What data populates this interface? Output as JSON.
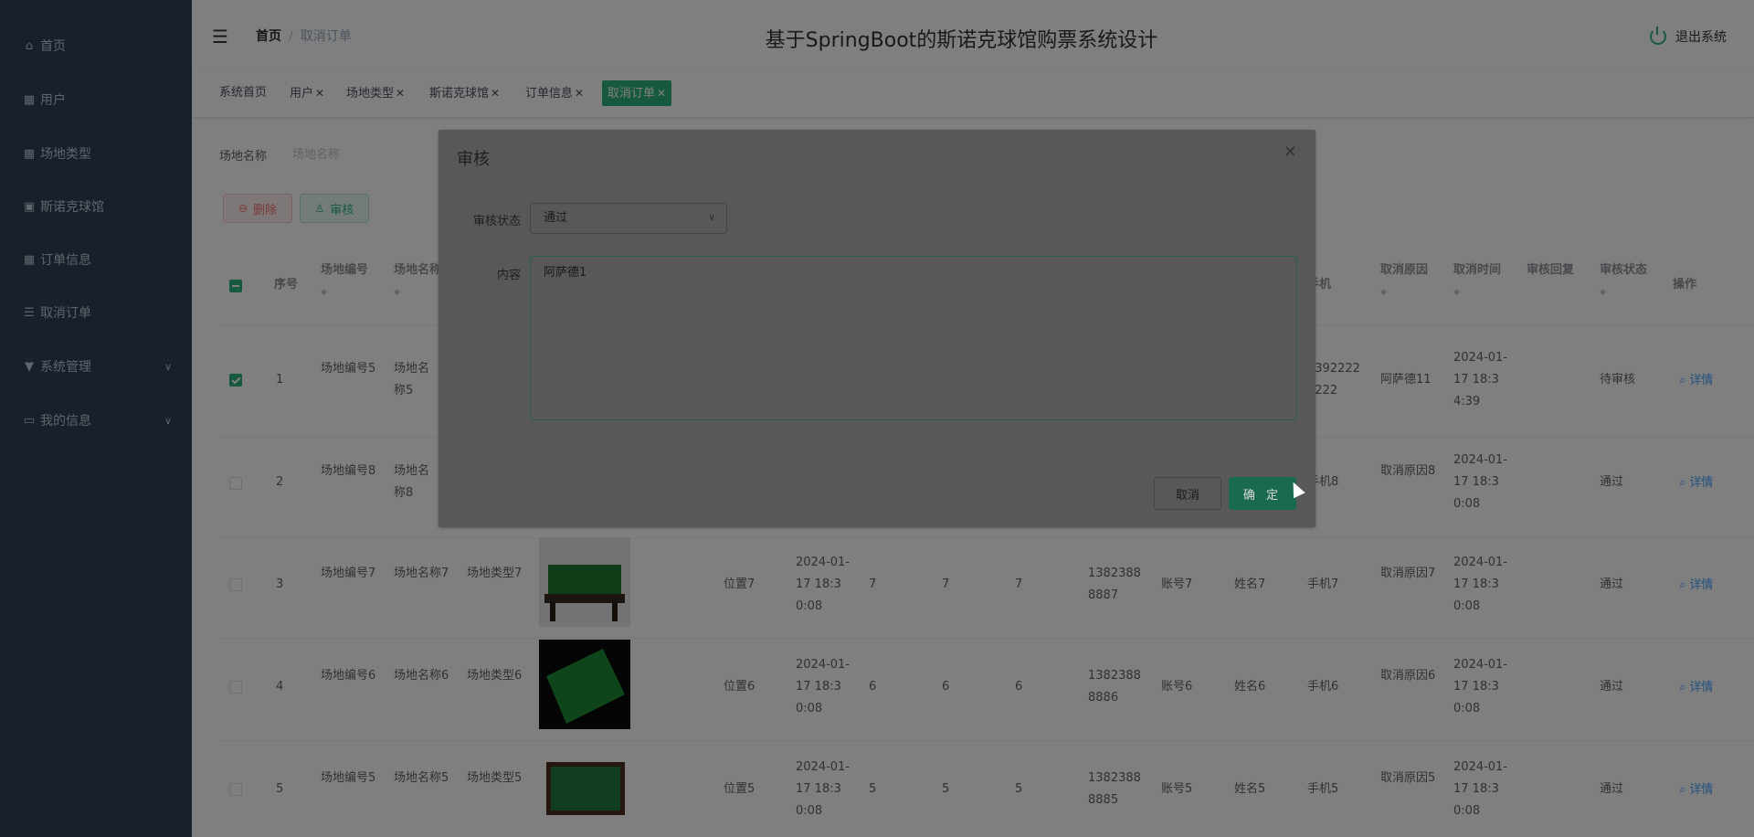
{
  "sidebar": {
    "items": [
      {
        "label": "首页",
        "icon": "home-icon"
      },
      {
        "label": "用户",
        "icon": "grid-icon"
      },
      {
        "label": "场地类型",
        "icon": "grid-icon"
      },
      {
        "label": "斯诺克球馆",
        "icon": "clipboard-icon"
      },
      {
        "label": "订单信息",
        "icon": "grid-icon"
      },
      {
        "label": "取消订单",
        "icon": "list-icon"
      },
      {
        "label": "系统管理",
        "icon": "settings-icon"
      },
      {
        "label": "我的信息",
        "icon": "profile-icon"
      }
    ]
  },
  "header": {
    "breadcrumb": [
      "首页",
      "取消订单"
    ],
    "title": "基于SpringBoot的斯诺克球馆购票系统设计",
    "logout": "退出系统"
  },
  "tags": [
    "系统首页",
    "用户",
    "场地类型",
    "斯诺克球馆",
    "订单信息",
    "取消订单"
  ],
  "search": {
    "label": "场地名称",
    "placeholder": "场地名称"
  },
  "toolbar": {
    "delete": "删除",
    "audit": "审核"
  },
  "table": {
    "headers": {
      "index": "序号",
      "code": "场地编号",
      "name": "场地名称",
      "phone": "手机",
      "reason": "取消原因",
      "time": "取消时间",
      "reply": "审核回复",
      "status": "审核状态",
      "action": "操作"
    },
    "rows": [
      {
        "idx": "1",
        "code": "场地编号5",
        "name": "场地名称5",
        "phone": "13922222222",
        "reason": "阿萨德11",
        "time": "2024-01-17 18:34:39",
        "status": "待审核",
        "detail": "详情"
      },
      {
        "idx": "2",
        "code": "场地编号8",
        "name": "场地名称8",
        "phone": "手机8",
        "reason": "取消原因8",
        "time": "2024-01-17 18:30:08",
        "status": "通过",
        "detail": "详情"
      },
      {
        "idx": "3",
        "code": "场地编号7",
        "name": "场地名称7",
        "type": "场地类型7",
        "position": "位置7",
        "date": "2024-01-17 18:30:08",
        "n1": "7",
        "n2": "7",
        "n3": "7",
        "mobile": "13823888887",
        "account": "账号7",
        "person": "姓名7",
        "phone": "手机7",
        "reason": "取消原因7",
        "time": "2024-01-17 18:30:08",
        "status": "通过",
        "detail": "详情"
      },
      {
        "idx": "4",
        "code": "场地编号6",
        "name": "场地名称6",
        "type": "场地类型6",
        "position": "位置6",
        "date": "2024-01-17 18:30:08",
        "n1": "6",
        "n2": "6",
        "n3": "6",
        "mobile": "13823888886",
        "account": "账号6",
        "person": "姓名6",
        "phone": "手机6",
        "reason": "取消原因6",
        "time": "2024-01-17 18:30:08",
        "status": "通过",
        "detail": "详情"
      },
      {
        "idx": "5",
        "code": "场地编号5",
        "name": "场地名称5",
        "type": "场地类型5",
        "position": "位置5",
        "date": "2024-01-17 18:30:08",
        "n1": "5",
        "n2": "5",
        "n3": "5",
        "mobile": "13823888885",
        "account": "账号5",
        "person": "姓名5",
        "phone": "手机5",
        "reason": "取消原因5",
        "time": "2024-01-17 18:30:08",
        "status": "通过",
        "detail": "详情"
      }
    ]
  },
  "dialog": {
    "title": "审核",
    "status_label": "审核状态",
    "status_value": "通过",
    "content_label": "内容",
    "content_value": "阿萨德1",
    "cancel": "取消",
    "ok": "确 定"
  },
  "colors": {
    "sidebar": "#304156",
    "accent": "#2db27d",
    "link": "#409eff"
  }
}
